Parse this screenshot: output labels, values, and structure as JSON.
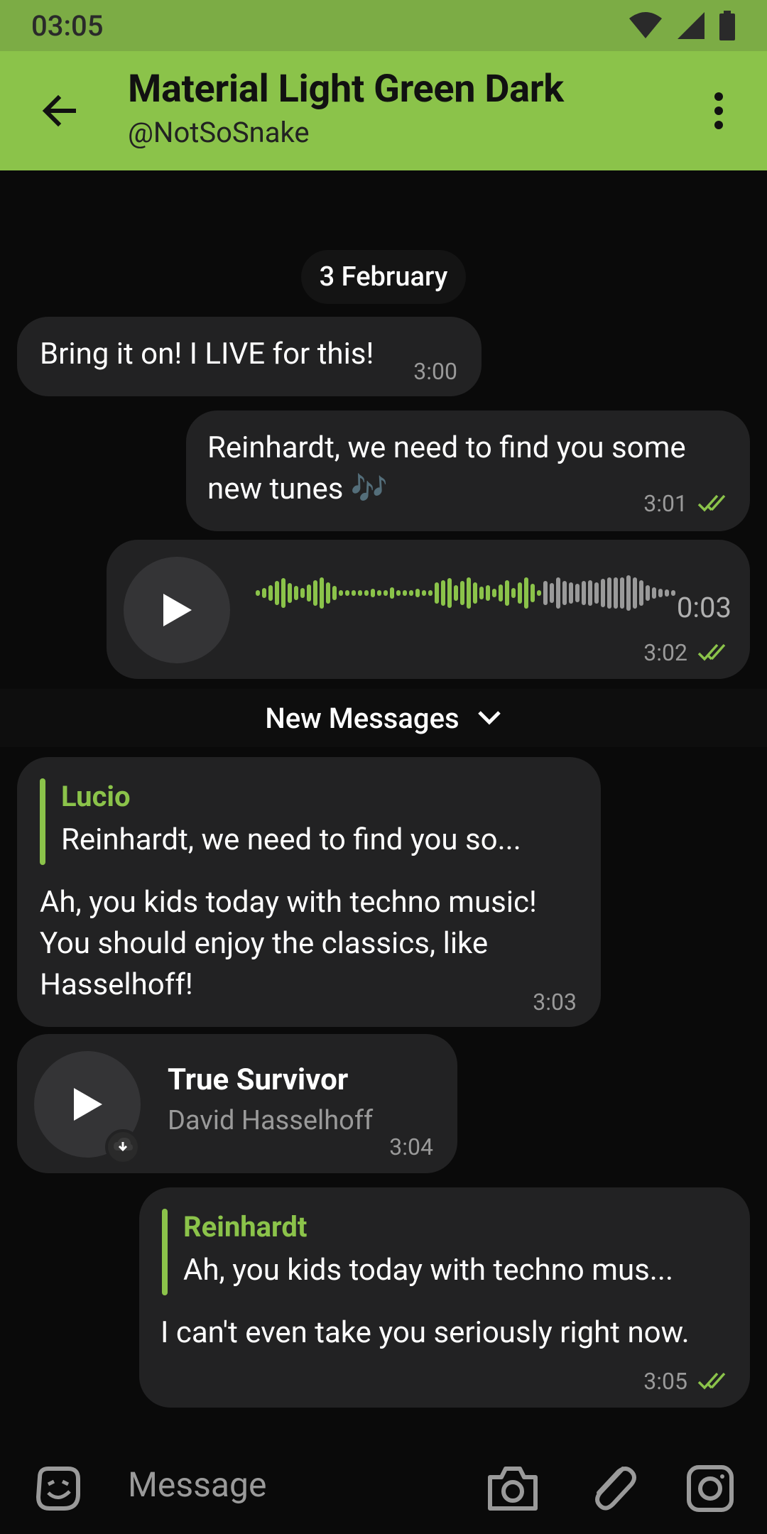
{
  "status": {
    "time": "03:05"
  },
  "header": {
    "title": "Material Light Green Dark",
    "subtitle": "@NotSoSnake"
  },
  "date_label": "3 February",
  "messages": {
    "m1": {
      "text": "Bring it on! I LIVE for this!",
      "time": "3:00"
    },
    "m2": {
      "line1": "Reinhardt, we need to find you some",
      "line2": "new tunes 🎶",
      "time": "3:01"
    },
    "voice": {
      "duration": "0:03",
      "time": "3:02",
      "played_fraction": 0.68
    },
    "m4": {
      "reply_name": "Lucio",
      "reply_text": "Reinhardt, we need to find you so...",
      "line1": "Ah, you kids today with techno music!",
      "line2": "You should enjoy the classics, like",
      "line3": "Hasselhoff!",
      "time": "3:03"
    },
    "audio": {
      "title": "True Survivor",
      "artist": "David Hasselhoff",
      "time": "3:04"
    },
    "m6": {
      "reply_name": "Reinhardt",
      "reply_text": "Ah, you kids today with techno mus...",
      "text": "I can't even take you seriously right now.",
      "time": "3:05"
    }
  },
  "new_messages_label": "New Messages",
  "input": {
    "placeholder": "Message"
  },
  "colors": {
    "accent": "#8bc34a",
    "bubble": "#222223",
    "background": "#0a0a0a"
  }
}
